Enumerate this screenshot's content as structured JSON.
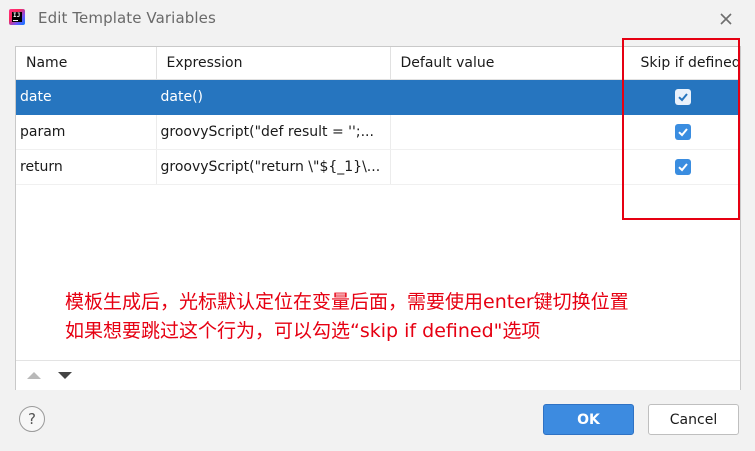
{
  "window": {
    "title": "Edit Template Variables",
    "app_icon": "intellij-icon",
    "close_icon": "close-icon"
  },
  "table": {
    "columns": [
      "Name",
      "Expression",
      "Default value",
      "Skip if defined"
    ],
    "rows": [
      {
        "name": "date",
        "expression": "date()",
        "default_value": "",
        "skip_if_defined": true,
        "selected": true
      },
      {
        "name": "param",
        "expression": "groovyScript(\"def result = '';...",
        "default_value": "",
        "skip_if_defined": true,
        "selected": false
      },
      {
        "name": "return",
        "expression": "groovyScript(\"return \\\"${_1}\\...",
        "default_value": "",
        "skip_if_defined": true,
        "selected": false
      }
    ]
  },
  "annotation": {
    "line1": "模板生成后，光标默认定位在变量后面，需要使用enter键切换位置",
    "line2": "如果想要跳过这个行为，可以勾选“skip if defined\"选项",
    "color": "#e60012"
  },
  "toolbar": {
    "move_up_icon": "arrow-up-icon",
    "move_down_icon": "arrow-down-icon"
  },
  "footer": {
    "help_label": "?",
    "ok_label": "OK",
    "cancel_label": "Cancel"
  },
  "colors": {
    "selection": "#2675bf",
    "checkbox": "#3a8de0",
    "primary_button": "#3d8be0"
  }
}
